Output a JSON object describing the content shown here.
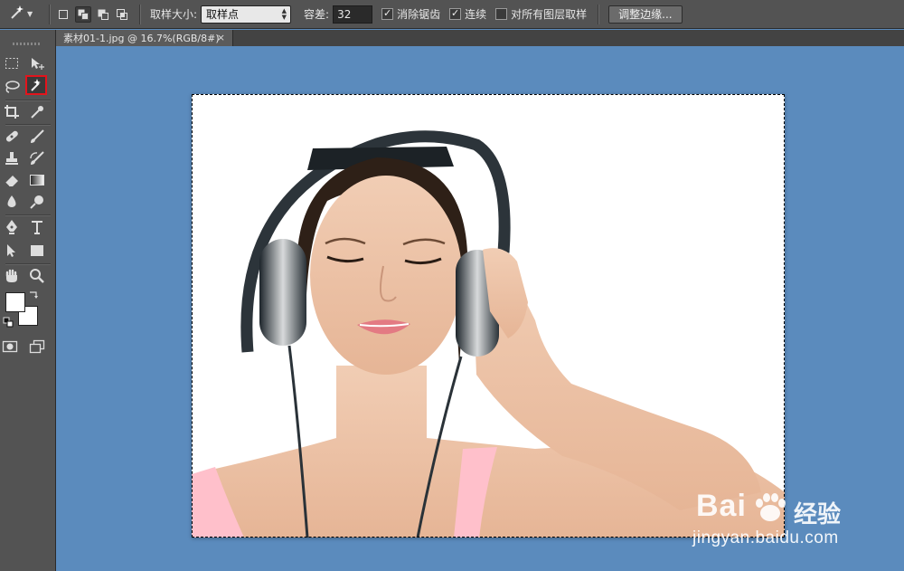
{
  "options_bar": {
    "sample_size_label": "取样大小:",
    "sample_size_value": "取样点",
    "tolerance_label": "容差:",
    "tolerance_value": "32",
    "antialias_label": "消除锯齿",
    "antialias_checked": true,
    "contiguous_label": "连续",
    "contiguous_checked": true,
    "all_layers_label": "对所有图层取样",
    "all_layers_checked": false,
    "refine_edge_label": "调整边缘..."
  },
  "document_tab": {
    "title": "素材01-1.jpg @ 16.7%(RGB/8#)",
    "close_glyph": "×"
  },
  "toolbox": {
    "selected_tool": "magic-wand",
    "foreground_color": "#ffffff",
    "background_color": "#ffffff"
  },
  "watermark": {
    "brand": "Bai",
    "brand_suffix": "经验",
    "url": "jingyan.baidu.com"
  },
  "colors": {
    "workspace_bg": "#5b8bbd",
    "panel_bg": "#535353",
    "selected_tool_border": "#e3141c",
    "photo_top": "#ffc0cb"
  }
}
